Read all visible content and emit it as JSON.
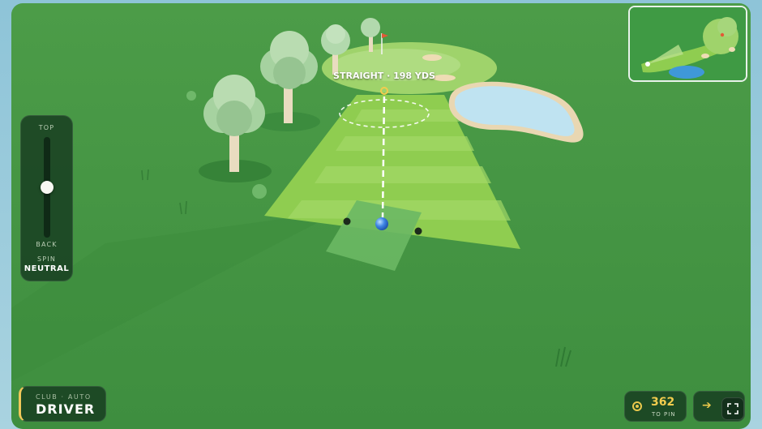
{
  "shot": {
    "label": "STRAIGHT · 198 YDS"
  },
  "spin": {
    "top_label": "TOP",
    "back_label": "BACK",
    "label": "SPIN",
    "value": "NEUTRAL",
    "level": 0.5
  },
  "club": {
    "mode_label": "CLUB · AUTO",
    "name": "DRIVER"
  },
  "distance": {
    "value": "362",
    "label": "TO PIN"
  },
  "icons": {
    "pin": "target-icon",
    "wind": "arrow-right-icon",
    "fullscreen": "fullscreen-icon"
  },
  "colors": {
    "rough": "#3f9a44",
    "fairway": "#8ecb4f",
    "green": "#9bd06a",
    "water": "#bfe3f1",
    "accent": "#f0c85a",
    "aim_line": "#ffffff"
  }
}
